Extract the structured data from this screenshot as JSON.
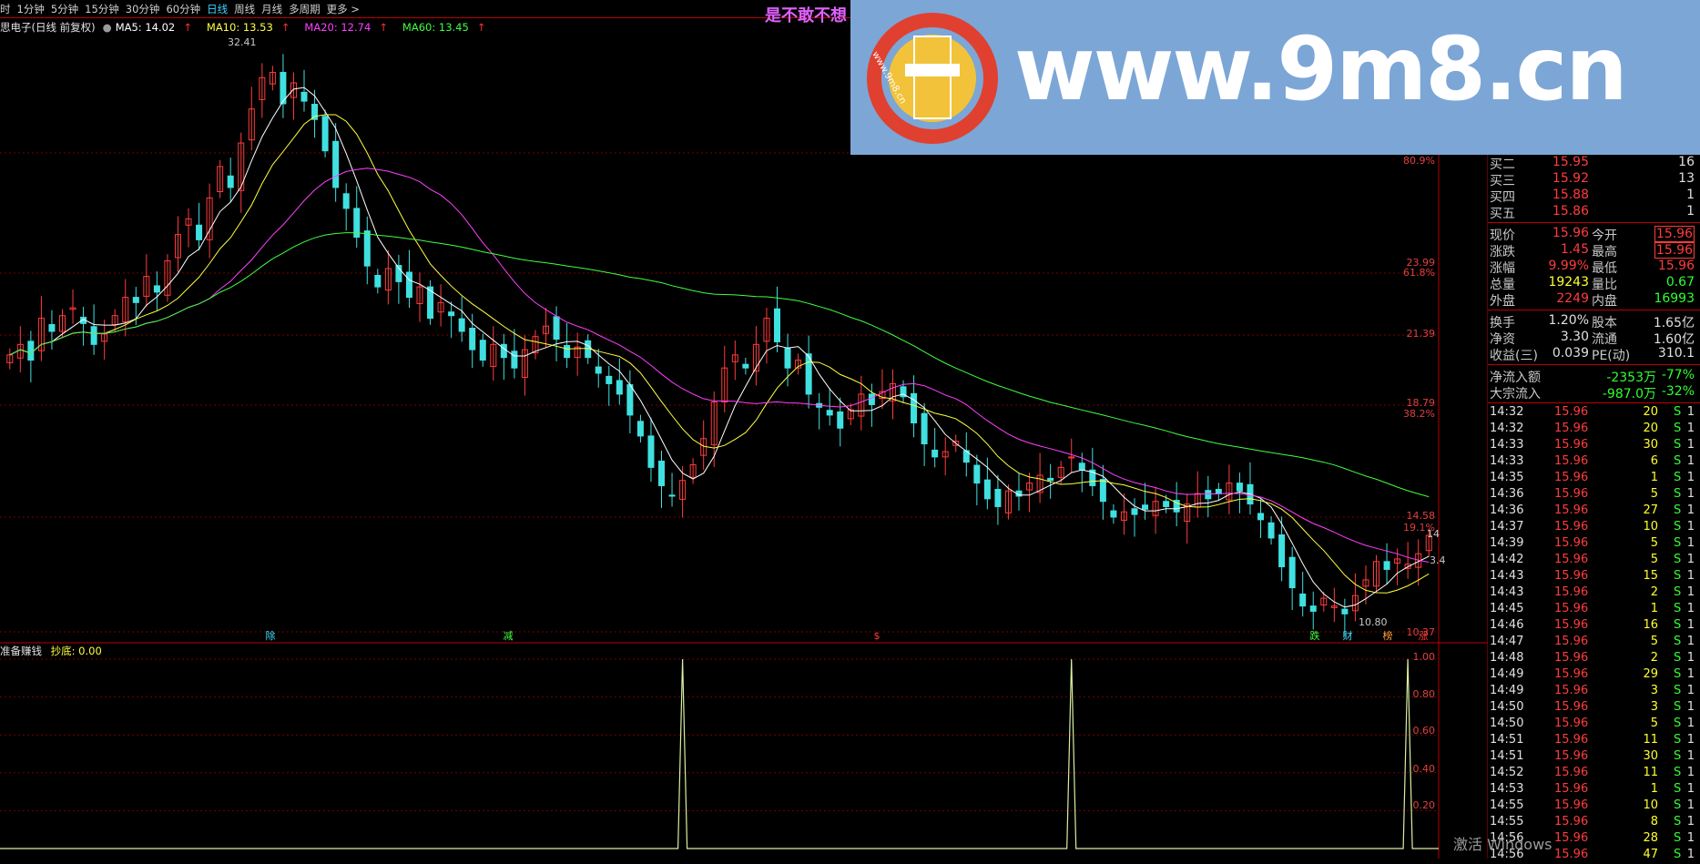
{
  "toolbar": {
    "items": [
      "时",
      "1分钟",
      "5分钟",
      "15分钟",
      "30分钟",
      "60分钟",
      "日线",
      "周线",
      "月线",
      "多周期",
      "更多 >"
    ],
    "active": "日线"
  },
  "ma_legend": {
    "title": "思电子(日线 前复权)",
    "ma5": "MA5: 14.02",
    "ma10": "MA10: 13.53",
    "ma20": "MA20: 12.74",
    "ma60": "MA60: 13.45",
    "colors": {
      "ma5": "#ffffff",
      "ma10": "#ffff40",
      "ma20": "#ff40ff",
      "ma60": "#40ff40"
    }
  },
  "ad_text": "是不敢不想",
  "banner": {
    "url": "www.9m8.cn",
    "circle_text": "www.9m8.cn",
    "color": "#7ca6d6"
  },
  "chart_data": [
    {
      "type": "candlestick",
      "title": "",
      "annotations": [
        "32.41",
        "10.80",
        "14",
        "3.4"
      ],
      "price_axis": {
        "ticks": [
          "80.9%",
          "23.99",
          "61.8%",
          "21.39",
          "18.79",
          "38.2%",
          "14.58",
          "19.1%",
          "10.37"
        ]
      },
      "event_markers": [
        "除",
        "减",
        "$",
        "跌",
        "财",
        "榜",
        "涨"
      ],
      "series": [
        {
          "name": "MA5",
          "color": "#ffffff"
        },
        {
          "name": "MA10",
          "color": "#ffff40"
        },
        {
          "name": "MA20",
          "color": "#ff40ff"
        },
        {
          "name": "MA60",
          "color": "#40ff40"
        }
      ],
      "close": [
        21.2,
        21.6,
        21.0,
        22.6,
        22.1,
        22.7,
        23.0,
        22.4,
        21.6,
        22.0,
        22.7,
        23.4,
        23.2,
        24.2,
        23.6,
        24.8,
        25.8,
        26.4,
        25.6,
        27.2,
        28.4,
        27.6,
        29.3,
        30.6,
        31.8,
        32.0,
        30.8,
        31.6,
        30.9,
        30.2,
        29.0,
        27.6,
        26.8,
        25.7,
        24.6,
        23.8,
        24.5,
        24.0,
        23.4,
        23.8,
        22.6,
        23.2,
        22.7,
        22.1,
        21.4,
        21.0,
        21.6,
        21.1,
        20.7,
        21.4,
        21.9,
        22.3,
        21.8,
        21.1,
        21.5,
        21.1,
        20.5,
        20.1,
        19.7,
        18.9,
        18.1,
        16.9,
        16.2,
        15.8,
        16.4,
        17.0,
        18.0,
        19.4,
        20.7,
        21.2,
        20.7,
        21.6,
        22.6,
        21.7,
        20.7,
        21.0,
        19.7,
        19.2,
        18.9,
        18.4,
        19.1,
        19.7,
        19.3,
        19.8,
        20.1,
        19.6,
        18.6,
        17.8,
        17.3,
        17.5,
        17.9,
        17.1,
        16.3,
        15.7,
        15.4,
        16.0,
        15.8,
        16.3,
        16.6,
        16.4,
        16.9,
        17.3,
        16.8,
        16.2,
        15.6,
        15.0,
        15.2,
        15.1,
        15.3,
        15.6,
        15.4,
        15.2,
        15.5,
        15.9,
        15.7,
        15.9,
        16.3,
        16.0,
        15.5,
        14.9,
        14.2,
        13.1,
        12.3,
        11.6,
        11.4,
        11.9,
        11.6,
        11.3,
        12.0,
        12.6,
        13.3,
        13.0,
        13.4,
        13.2,
        13.6,
        14.3
      ],
      "indicator": {
        "name": "准备赚钱",
        "label": "抄底: 0.00",
        "ticks": [
          "1.00",
          "0.80",
          "0.60",
          "0.40",
          "0.20"
        ],
        "ylim": [
          0,
          1
        ],
        "spikes": [
          64,
          101,
          133
        ]
      }
    }
  ],
  "quote": {
    "bids": [
      {
        "label": "买二",
        "price": "15.95",
        "vol": "16"
      },
      {
        "label": "买三",
        "price": "15.92",
        "vol": "13"
      },
      {
        "label": "买四",
        "price": "15.88",
        "vol": "1"
      },
      {
        "label": "买五",
        "price": "15.86",
        "vol": "1"
      }
    ],
    "stats": [
      {
        "l1": "现价",
        "v1": "15.96",
        "l2": "今开",
        "v2": "15.96"
      },
      {
        "l1": "涨跌",
        "v1": "1.45",
        "l2": "最高",
        "v2": "15.96"
      },
      {
        "l1": "涨幅",
        "v1": "9.99%",
        "l2": "最低",
        "v2": "15.96"
      },
      {
        "l1": "总量",
        "v1": "19243",
        "l2": "量比",
        "v2": "0.67"
      },
      {
        "l1": "外盘",
        "v1": "2249",
        "l2": "内盘",
        "v2": "16993"
      }
    ],
    "fund": [
      {
        "l1": "换手",
        "v1": "1.20%",
        "l2": "股本",
        "v2": "1.65亿"
      },
      {
        "l1": "净资",
        "v1": "3.30",
        "l2": "流通",
        "v2": "1.60亿"
      },
      {
        "l1": "收益(三)",
        "v1": "0.039",
        "l2": "PE(动)",
        "v2": "310.1"
      }
    ],
    "flows": [
      {
        "label": "净流入额",
        "val": "-2353万",
        "pct": "-77%"
      },
      {
        "label": "大宗流入",
        "val": "-987.0万",
        "pct": "-32%"
      }
    ],
    "ticks": [
      {
        "t": "14:32",
        "p": "15.96",
        "v": "20",
        "s": "S",
        "n": "1"
      },
      {
        "t": "14:32",
        "p": "15.96",
        "v": "20",
        "s": "S",
        "n": "1"
      },
      {
        "t": "14:33",
        "p": "15.96",
        "v": "30",
        "s": "S",
        "n": "1"
      },
      {
        "t": "14:33",
        "p": "15.96",
        "v": "6",
        "s": "S",
        "n": "1"
      },
      {
        "t": "14:35",
        "p": "15.96",
        "v": "1",
        "s": "S",
        "n": "1"
      },
      {
        "t": "14:36",
        "p": "15.96",
        "v": "5",
        "s": "S",
        "n": "1"
      },
      {
        "t": "14:36",
        "p": "15.96",
        "v": "27",
        "s": "S",
        "n": "1"
      },
      {
        "t": "14:37",
        "p": "15.96",
        "v": "10",
        "s": "S",
        "n": "1"
      },
      {
        "t": "14:39",
        "p": "15.96",
        "v": "5",
        "s": "S",
        "n": "1"
      },
      {
        "t": "14:42",
        "p": "15.96",
        "v": "5",
        "s": "S",
        "n": "1"
      },
      {
        "t": "14:43",
        "p": "15.96",
        "v": "15",
        "s": "S",
        "n": "1"
      },
      {
        "t": "14:43",
        "p": "15.96",
        "v": "2",
        "s": "S",
        "n": "1"
      },
      {
        "t": "14:45",
        "p": "15.96",
        "v": "1",
        "s": "S",
        "n": "1"
      },
      {
        "t": "14:46",
        "p": "15.96",
        "v": "16",
        "s": "S",
        "n": "1"
      },
      {
        "t": "14:47",
        "p": "15.96",
        "v": "5",
        "s": "S",
        "n": "1"
      },
      {
        "t": "14:48",
        "p": "15.96",
        "v": "2",
        "s": "S",
        "n": "1"
      },
      {
        "t": "14:49",
        "p": "15.96",
        "v": "29",
        "s": "S",
        "n": "1"
      },
      {
        "t": "14:49",
        "p": "15.96",
        "v": "3",
        "s": "S",
        "n": "1"
      },
      {
        "t": "14:50",
        "p": "15.96",
        "v": "3",
        "s": "S",
        "n": "1"
      },
      {
        "t": "14:50",
        "p": "15.96",
        "v": "5",
        "s": "S",
        "n": "1"
      },
      {
        "t": "14:51",
        "p": "15.96",
        "v": "11",
        "s": "S",
        "n": "1"
      },
      {
        "t": "14:51",
        "p": "15.96",
        "v": "30",
        "s": "S",
        "n": "1"
      },
      {
        "t": "14:52",
        "p": "15.96",
        "v": "11",
        "s": "S",
        "n": "1"
      },
      {
        "t": "14:53",
        "p": "15.96",
        "v": "1",
        "s": "S",
        "n": "1"
      },
      {
        "t": "14:55",
        "p": "15.96",
        "v": "10",
        "s": "S",
        "n": "1"
      },
      {
        "t": "14:55",
        "p": "15.96",
        "v": "8",
        "s": "S",
        "n": "1"
      },
      {
        "t": "14:56",
        "p": "15.96",
        "v": "28",
        "s": "S",
        "n": "1"
      },
      {
        "t": "14:56",
        "p": "15.96",
        "v": "47",
        "s": "S",
        "n": "1"
      }
    ]
  },
  "watermark": "激活 Windows"
}
